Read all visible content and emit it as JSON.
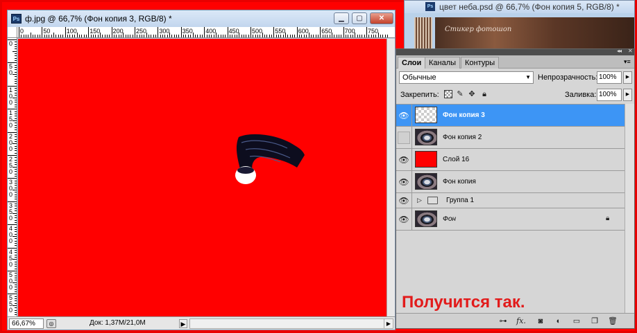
{
  "document": {
    "title": "ф.jpg @ 66,7% (Фон копия 3, RGB/8) *",
    "app_icon": "Ps",
    "zoom": "66,67%",
    "status": "Док: 1,37M/21,0M",
    "ruler_top_labels": [
      "0",
      "50",
      "100",
      "150",
      "200",
      "250",
      "300",
      "350",
      "400",
      "450",
      "500",
      "550",
      "600",
      "650",
      "700",
      "750"
    ],
    "ruler_left_labels": [
      "0",
      "50",
      "100",
      "150",
      "200",
      "250",
      "300",
      "350",
      "400",
      "450",
      "500",
      "550"
    ],
    "canvas_color": "#ff0000"
  },
  "document2": {
    "title": "цвет неба.psd @ 66,7% (Фон копия 5, RGB/8) *",
    "app_icon": "Ps",
    "image_text": "Стикер фотошоп"
  },
  "panel": {
    "tabs": [
      "Слои",
      "Каналы",
      "Контуры"
    ],
    "active_tab": "Слои",
    "blend_mode": "Обычные",
    "opacity_label": "Непрозрачность:",
    "opacity_value": "100%",
    "lock_label": "Закрепить:",
    "fill_label": "Заливка:",
    "fill_value": "100%",
    "layers": [
      {
        "name": "Фон копия 3",
        "visible": true,
        "selected": true,
        "thumb": "transparent"
      },
      {
        "name": "Фон копия 2",
        "visible": false,
        "selected": false,
        "thumb": "eye"
      },
      {
        "name": "Слой 16",
        "visible": true,
        "selected": false,
        "thumb": "red"
      },
      {
        "name": "Фон копия",
        "visible": true,
        "selected": false,
        "thumb": "eye"
      },
      {
        "name": "Группа 1",
        "visible": true,
        "selected": false,
        "thumb": "folder"
      },
      {
        "name": "Фон",
        "visible": true,
        "selected": false,
        "thumb": "eye",
        "locked": true
      }
    ]
  },
  "caption": "Получится так.",
  "colors": {
    "selection": "#3d95f5",
    "caption": "#e21b1b",
    "frame": "#e80000"
  }
}
